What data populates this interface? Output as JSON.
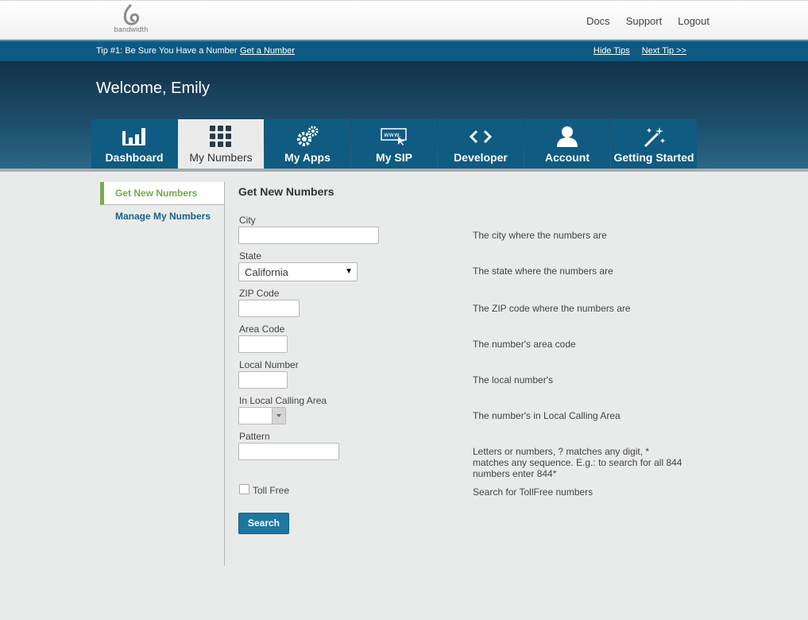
{
  "brand": {
    "logo_text": "bandwidth"
  },
  "top_nav": {
    "docs": "Docs",
    "support": "Support",
    "logout": "Logout"
  },
  "tip_bar": {
    "tip": "Tip #1: Be Sure You Have a Number",
    "action": "Get a Number",
    "hide": "Hide Tips",
    "next": "Next Tip >>"
  },
  "welcome": "Welcome, Emily",
  "tabs": [
    {
      "label": "Dashboard",
      "icon": "bar-chart-icon"
    },
    {
      "label": "My Numbers",
      "icon": "keypad-icon",
      "active": true
    },
    {
      "label": "My Apps",
      "icon": "gears-icon"
    },
    {
      "label": "My SIP",
      "icon": "www-browser-icon"
    },
    {
      "label": "Developer",
      "icon": "code-icon"
    },
    {
      "label": "Account",
      "icon": "user-icon"
    },
    {
      "label": "Getting Started",
      "icon": "magic-wand-icon"
    }
  ],
  "sidebar": {
    "items": [
      {
        "label": "Get New Numbers",
        "active": true
      },
      {
        "label": "Manage My Numbers"
      }
    ]
  },
  "form": {
    "title": "Get New Numbers",
    "city": {
      "label": "City",
      "value": "",
      "help": "The city where the numbers are"
    },
    "state": {
      "label": "State",
      "value": "California",
      "help": "The state where the numbers are"
    },
    "zip": {
      "label": "ZIP Code",
      "value": "",
      "help": "The ZIP code where the numbers are"
    },
    "area_code": {
      "label": "Area Code",
      "value": "",
      "help": "The number's area code"
    },
    "local_number": {
      "label": "Local Number",
      "value": "",
      "help": "The local number's"
    },
    "local_calling": {
      "label": "In Local Calling Area",
      "value": "",
      "help": "The number's in Local Calling Area"
    },
    "pattern": {
      "label": "Pattern",
      "value": "",
      "help": "Letters or numbers, ? matches any digit, * matches any sequence. E.g.: to search for all 844 numbers enter 844*"
    },
    "toll_free": {
      "label": "Toll Free",
      "checked": false,
      "help": "Search for TollFree numbers"
    },
    "search_label": "Search"
  },
  "colors": {
    "tip_bar": "#0c5a82",
    "tab": "#0f5b82",
    "sidebar_active": "#76a84e",
    "search_button": "#1c77a1"
  }
}
